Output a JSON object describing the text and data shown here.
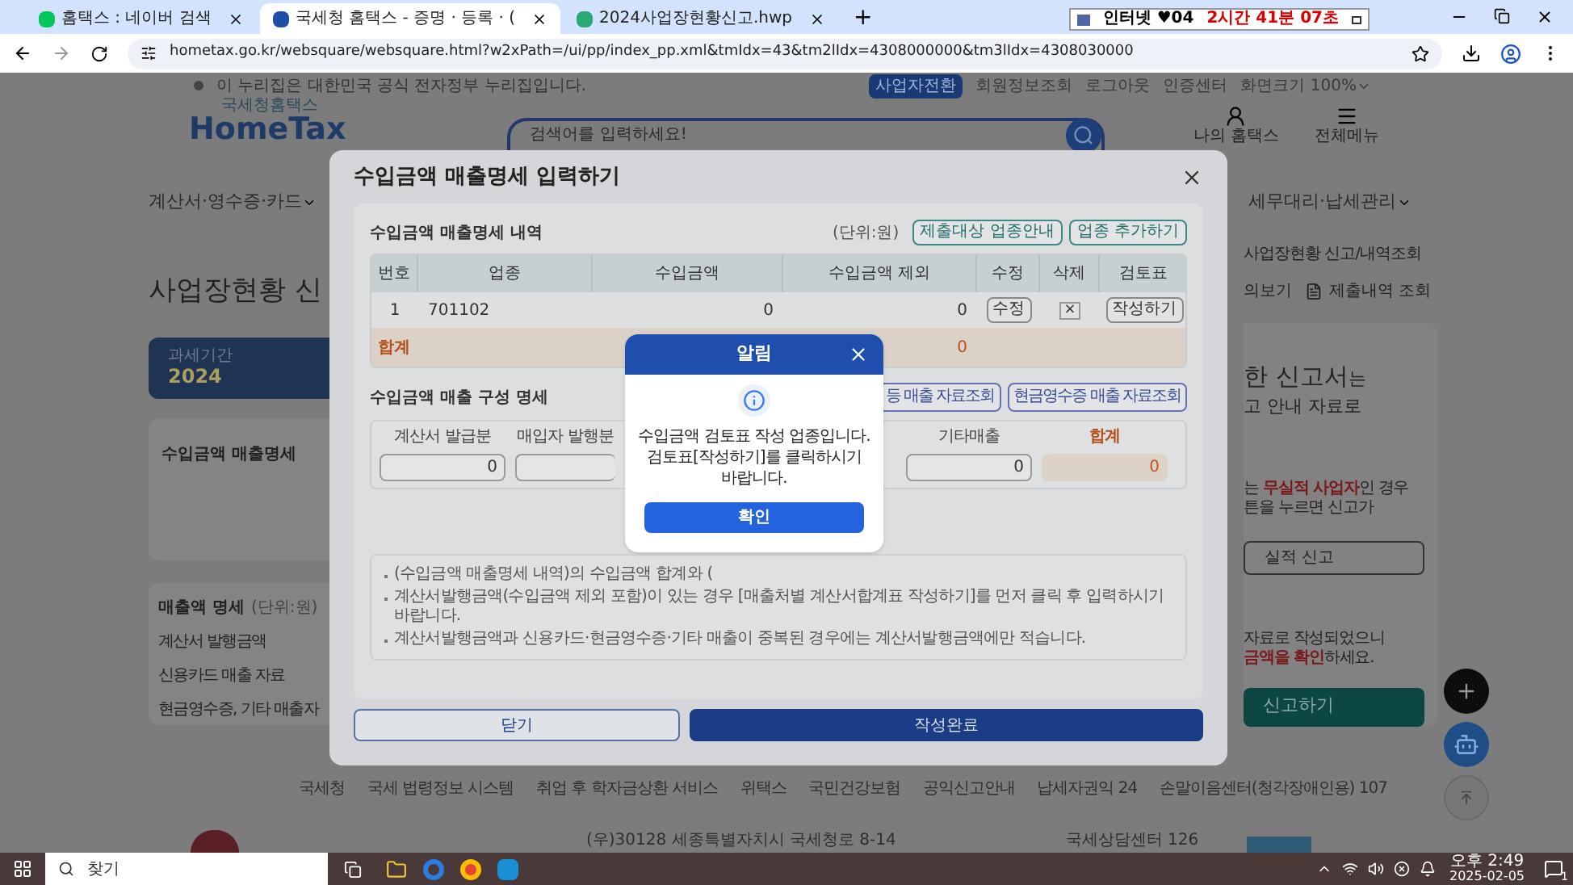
{
  "browser": {
    "tabs": [
      {
        "title": "홈택스 : 네이버 검색",
        "selected": false
      },
      {
        "title": "국세청 홈택스 - 증명 · 등록 · (",
        "selected": true
      },
      {
        "title": "2024사업장현황신고.hwp",
        "selected": false
      }
    ],
    "new_tab": "+",
    "session": {
      "label": "인터넷 ♥04",
      "timer": "2시간 41분 07초"
    },
    "url": "hometax.go.kr/websquare/websquare.html?w2xPath=/ui/pp/index_pp.xml&tmIdx=43&tm2lIdx=4308000000&tm3lIdx=4308030000"
  },
  "page": {
    "notice": "이 누리집은 대한민국 공식 전자정부 누리집입니다.",
    "top_links": [
      {
        "label": "사업자전환",
        "kind": "badge"
      },
      {
        "label": "회원정보조회",
        "kind": "link"
      },
      {
        "label": "로그아웃",
        "kind": "link"
      },
      {
        "label": "인증센터",
        "kind": "link"
      },
      {
        "label": "화면크기 100%",
        "kind": "dropdown"
      }
    ],
    "logo": {
      "small": "국세청홈택스",
      "main": "HomeTax"
    },
    "search": {
      "placeholder": "검색어를 입력하세요!"
    },
    "header_icons": [
      {
        "label": "나의 홈택스",
        "kind": "my"
      },
      {
        "label": "전체메뉴",
        "kind": "menu"
      }
    ],
    "nav_left": "계산서·영수증·카드",
    "nav_right": "세무대리·납세관리",
    "title": "사업장현황 신",
    "period": {
      "label": "과세기간",
      "value": "2024"
    },
    "card_title": "수입금액 매출명세",
    "sales": {
      "title": "매출액 명세",
      "unit": "(단위:원)",
      "rows": [
        "계산서 발행금액",
        "신용카드 매출 자료",
        "현금영수증, 기타 매출자"
      ]
    },
    "breadcrumb": "사업장현황 신고/내역조회",
    "right_links": [
      {
        "label": "의보기",
        "kind": "text"
      },
      {
        "label": "제출내역 조회",
        "kind": "doc"
      }
    ],
    "headline": "한 신고서",
    "headline_suffix": "는",
    "subline": "고 안내 자료로",
    "note_a": [
      {
        "text": "는 ",
        "emphasis": false
      },
      {
        "text": "무실적 사업자",
        "emphasis": true
      },
      {
        "text": "인 경우",
        "emphasis": false
      }
    ],
    "note_a2": "튼을 누르면 신고가",
    "nil_button": "실적 신고",
    "note_b": "자료로 작성되었으니",
    "note_b2": [
      {
        "text": "금액을 확인",
        "emphasis": true
      },
      {
        "text": "하세요.",
        "emphasis": false
      }
    ],
    "submit_button": "신고하기",
    "footer_links": [
      "국세청",
      "국세 법령정보 시스템",
      "취업 후 학자금상환 서비스",
      "위택스",
      "국민건강보험",
      "공익신고안내",
      "납세자권익 24",
      "손말이음센터(청각장애인용) 107"
    ],
    "address": "(우)30128 세종특별자치시 국세청로 8-14",
    "call_center": "국세상담센터 126"
  },
  "modal": {
    "title": "수입금액 매출명세 입력하기",
    "section1": {
      "title": "수입금액 매출명세 내역",
      "unit": "(단위:원)",
      "buttons": [
        "제출대상 업종안내",
        "업종 추가하기"
      ],
      "columns": [
        "번호",
        "업종",
        "수입금액",
        "수입금액 제외",
        "수정",
        "삭제",
        "검토표"
      ],
      "rows": [
        {
          "no": "1",
          "industry": "701102",
          "amount": "0",
          "excluded": "0",
          "edit": "수정",
          "delete": "×",
          "review": "작성하기"
        }
      ],
      "total": {
        "label": "합계",
        "excluded": "0"
      }
    },
    "section2": {
      "title": "수입금액 매출 구성 명세",
      "buttons": [
        "등 매출 자료조회",
        "현금영수증 매출 자료조회"
      ],
      "fields": [
        {
          "label": "계산서 발급분",
          "value": "0",
          "kind": "normal"
        },
        {
          "label": "매입자 발행분",
          "kind": "cut"
        },
        {
          "label": "기타매출",
          "value": "0",
          "kind": "normal"
        },
        {
          "label": "합계",
          "value": "0",
          "kind": "total"
        }
      ]
    },
    "notes": [
      "(수입금액 매출명세 내역)의 수입금액 합계와 (",
      "계산서발행금액(수입금액 제외 포함)이 있는 경우 [매출처별 계산서합계표 작성하기]를 먼저 클릭 후 입력하시기 바랍니다.",
      "계산서발행금액과 신용카드·현금영수증·기타 매출이 중복된 경우에는 계산서발행금액에만 적습니다."
    ],
    "buttons": [
      {
        "label": "닫기",
        "kind": "secondary"
      },
      {
        "label": "작성완료",
        "kind": "primary"
      }
    ]
  },
  "alert": {
    "title": "알림",
    "message": "수입금액 검토표 작성 업종입니다. 검토표[작성하기]를 클릭하시기 바랍니다.",
    "button": "확인"
  },
  "taskbar": {
    "search_placeholder": "찾기",
    "time": "오후 2:49",
    "date": "2025-02-05",
    "notifications": "1"
  }
}
